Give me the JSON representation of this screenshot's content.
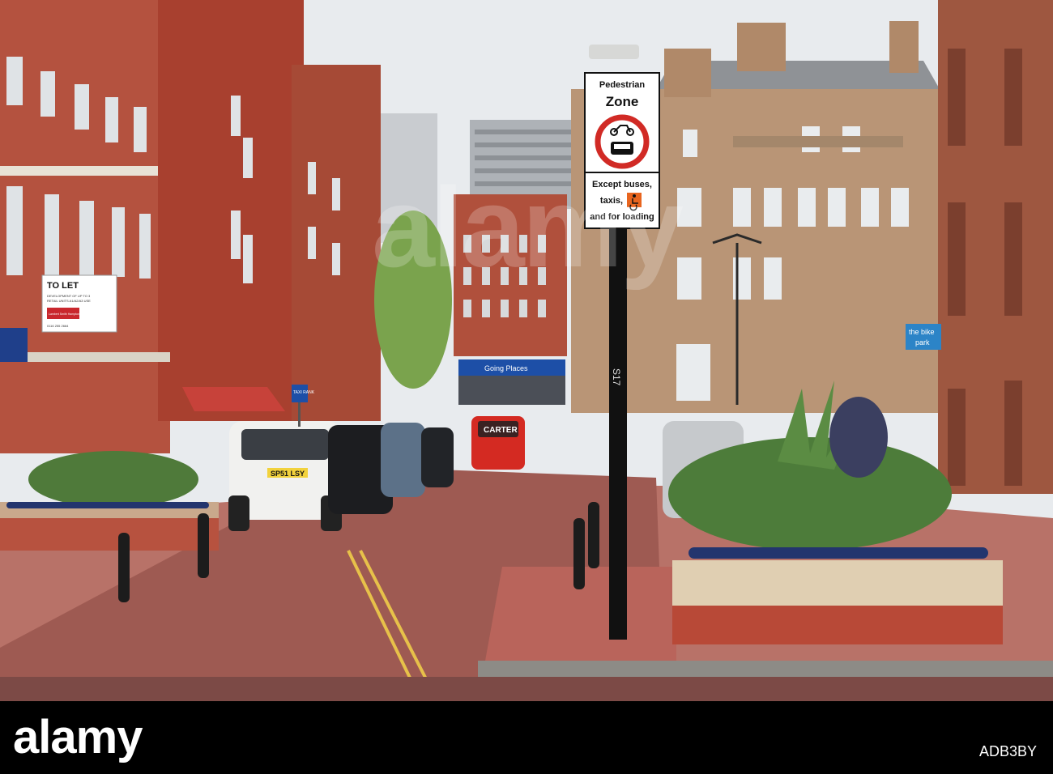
{
  "photo": {
    "description_free": true,
    "sign": {
      "line1": "Pedestrian",
      "line2": "Zone",
      "except1": "Except buses,",
      "except2": "taxis,",
      "except3": "and for loading",
      "post_code": "S17"
    },
    "to_let_board": {
      "title": "TO LET",
      "line1": "DEVELOPMENT OF UP TO 3",
      "line2": "RETAIL UNITS A1/A2/A3 USE",
      "agent": "Lambert Smith Hampton",
      "phone": "0116 255 2664"
    },
    "shopfront": "Going Places",
    "taxi_rank_sign": "TAXI RANK",
    "van_text": "CARTER",
    "taxi_plate": "SP51 LSY",
    "bike_park_sign": {
      "line1": "the bike",
      "line2": "park"
    }
  },
  "footer": {
    "logo": "alamy",
    "image_id": "ADB3BY"
  },
  "colors": {
    "brick": "#b14f3c",
    "paving": "#b5685e",
    "sky": "#e8ebee",
    "footer_bg": "#000000"
  }
}
